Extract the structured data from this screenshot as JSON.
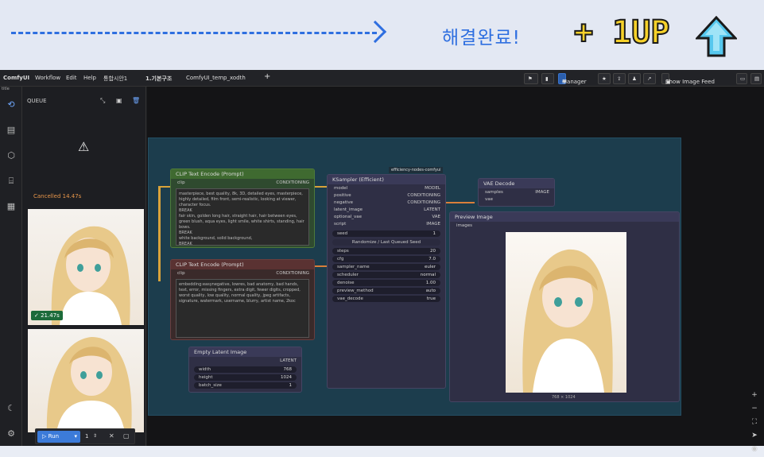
{
  "banner": {
    "done_text": "해결완료!",
    "oneup_text": "+ 1UP"
  },
  "app": {
    "logo": "ComfyUI",
    "menu": [
      "Workflow",
      "Edit",
      "Help"
    ],
    "tabs": [
      "통합시안1",
      "1.기본구조",
      "ComfyUI_temp_xodth"
    ],
    "toolbar": {
      "manager": "Manager",
      "show_feed": "Show Image Feed"
    },
    "side_label": "title",
    "queue": {
      "title": "QUEUE",
      "status": "Cancelled 14.47s",
      "badge": "21.47s"
    },
    "run": {
      "label": "Run",
      "count": "1"
    }
  },
  "nodes": {
    "clip_pos": {
      "title": "CLIP Text Encode (Prompt)",
      "clip_label": "clip",
      "conditioning_label": "CONDITIONING",
      "text": "masterpiece, best quality, 8k, 3D, detailed eyes, masterpiece, highly detailed, film front, semi-realistic, looking at viewer, character focus.\nBREAK\nfair skin, golden long hair, straight hair, hair between eyes, green blush, aqua eyes, light smile, white shirts, standing, hair bows.\nBREAK\nwhite background, solid background,\nBREAK"
    },
    "clip_neg": {
      "title": "CLIP Text Encode (Prompt)",
      "clip_label": "clip",
      "conditioning_label": "CONDITIONING",
      "text": "embedding:easynegative, lowres, bad anatomy, bad hands, text, error, missing fingers, extra digit, fewer digits, cropped, worst quality, low quality, normal quality, jpeg artifacts, signature, watermark, username, blurry, artist name, 2koc"
    },
    "latent": {
      "title": "Empty Latent Image",
      "out": "LATENT",
      "rows": [
        {
          "k": "width",
          "v": "768"
        },
        {
          "k": "height",
          "v": "1024"
        },
        {
          "k": "batch_size",
          "v": "1"
        }
      ]
    },
    "ksampler": {
      "title": "KSampler (Efficient)",
      "tag": "efficiency-nodes-comfyui",
      "inputs": [
        {
          "k": "model",
          "v": "MODEL"
        },
        {
          "k": "positive",
          "v": "CONDITIONING"
        },
        {
          "k": "negative",
          "v": "CONDITIONING"
        },
        {
          "k": "latent_image",
          "v": "LATENT"
        },
        {
          "k": "optional_vae",
          "v": "VAE"
        },
        {
          "k": "script",
          "v": "IMAGE"
        }
      ],
      "seed_label": "seed",
      "seed_value": "1",
      "seed_btn": "Randomize / Last Queued Seed",
      "rows": [
        {
          "k": "steps",
          "v": "20"
        },
        {
          "k": "cfg",
          "v": "7.0"
        },
        {
          "k": "sampler_name",
          "v": "euler"
        },
        {
          "k": "scheduler",
          "v": "normal"
        },
        {
          "k": "denoise",
          "v": "1.00"
        },
        {
          "k": "preview_method",
          "v": "auto"
        },
        {
          "k": "vae_decode",
          "v": "true"
        }
      ]
    },
    "vae": {
      "title": "VAE Decode",
      "inputs": [
        {
          "k": "samples",
          "v": "IMAGE"
        },
        {
          "k": "vae",
          "v": ""
        }
      ]
    },
    "preview": {
      "title": "Preview Image",
      "input": "images",
      "size": "768 × 1024"
    }
  },
  "colors": {
    "accent": "#2f6fe0",
    "manager": "#2b5fae",
    "run": "#3c7bd9",
    "cancelled": "#e8964a",
    "badge": "#1c6b3a"
  }
}
